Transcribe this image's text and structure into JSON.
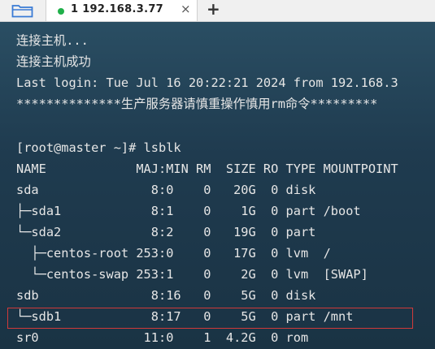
{
  "tab": {
    "number": "1",
    "host": "192.168.3.77",
    "close": "×",
    "new_tab": "+"
  },
  "terminal": {
    "lines": [
      "连接主机...",
      "连接主机成功",
      "Last login: Tue Jul 16 20:22:21 2024 from 192.168.3",
      "**************生产服务器请慎重操作慎用rm命令*********",
      "",
      "[root@master ~]# lsblk",
      "NAME            MAJ:MIN RM  SIZE RO TYPE MOUNTPOINT",
      "sda               8:0    0   20G  0 disk",
      "├─sda1            8:1    0    1G  0 part /boot",
      "└─sda2            8:2    0   19G  0 part",
      "  ├─centos-root 253:0    0   17G  0 lvm  /",
      "  └─centos-swap 253:1    0    2G  0 lvm  [SWAP]",
      "sdb               8:16   0    5G  0 disk",
      "└─sdb1            8:17   0    5G  0 part /mnt",
      "sr0              11:0    1  4.2G  0 rom"
    ]
  },
  "colors": {
    "terminal_bg": "#1e3a4d",
    "highlight_border": "#d03a3a",
    "status_dot": "#20b04a"
  }
}
